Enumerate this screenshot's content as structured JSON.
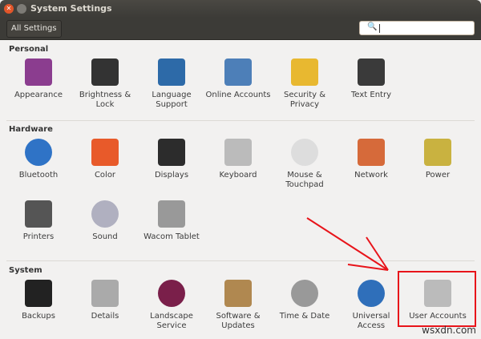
{
  "window": {
    "title": "System Settings"
  },
  "toolbar": {
    "all_settings": "All Settings",
    "search_placeholder": ""
  },
  "sections": [
    {
      "title": "Personal",
      "items": [
        "Appearance",
        "Brightness & Lock",
        "Language Support",
        "Online Accounts",
        "Security & Privacy",
        "Text Entry"
      ]
    },
    {
      "title": "Hardware",
      "items": [
        "Bluetooth",
        "Color",
        "Displays",
        "Keyboard",
        "Mouse & Touchpad",
        "Network",
        "Power",
        "Printers",
        "Sound",
        "Wacom Tablet"
      ]
    },
    {
      "title": "System",
      "items": [
        "Backups",
        "Details",
        "Landscape Service",
        "Software & Updates",
        "Time & Date",
        "Universal Access",
        "User Accounts"
      ]
    }
  ],
  "colors": {
    "appearance": "#8b3d8f",
    "brightness": "#333333",
    "language": "#2d6aa8",
    "online": "#4d7fb8",
    "security": "#e8b830",
    "textentry": "#3a3a3a",
    "bluetooth": "#2f73c6",
    "color": "#e85a2a",
    "displays": "#2c2c2c",
    "keyboard": "#bbbbbb",
    "mouse": "#dddddd",
    "network": "#d66a3a",
    "power": "#c9b240",
    "printers": "#555555",
    "sound": "#b0b0c0",
    "wacom": "#999999",
    "backups": "#222222",
    "details": "#aaaaaa",
    "landscape": "#7a1f4a",
    "software": "#b08850",
    "time": "#999999",
    "universal": "#2f6fba",
    "users": "#bbbbbb"
  },
  "watermark": "wsxdn.com"
}
